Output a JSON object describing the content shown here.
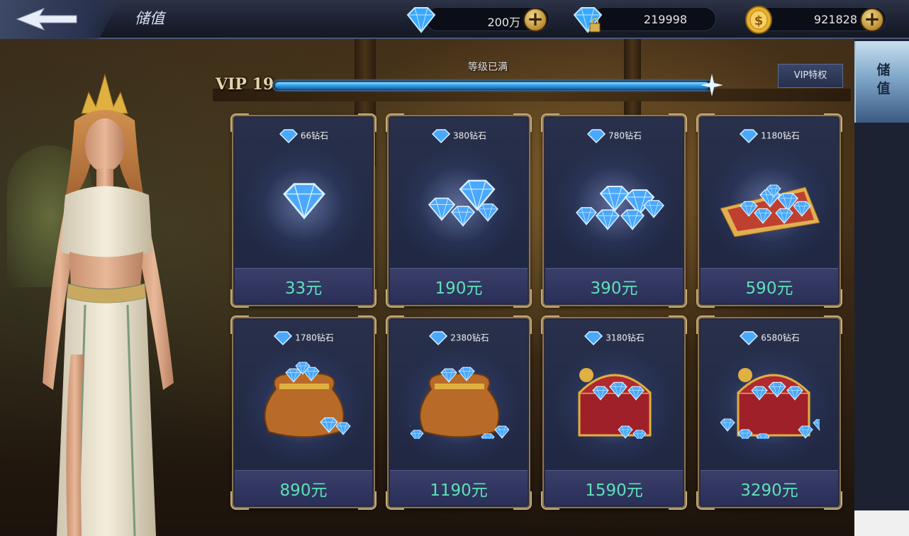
{
  "header": {
    "title": "储值",
    "currencies": [
      {
        "icon": "diamond-icon",
        "amount": "200万"
      },
      {
        "icon": "locked-diamond-icon",
        "amount": "219998"
      },
      {
        "icon": "gold-coin-icon",
        "amount": "921828"
      }
    ]
  },
  "vip": {
    "label": "VIP 19",
    "status": "等级已满",
    "progress": 1.0,
    "privilege_button": "VIP特权"
  },
  "side_tab": {
    "label": "储值"
  },
  "products": [
    {
      "gems": "66钻石",
      "price": "33元",
      "art": "single-diamond"
    },
    {
      "gems": "380钻石",
      "price": "190元",
      "art": "diamond-pile-small"
    },
    {
      "gems": "780钻石",
      "price": "390元",
      "art": "diamond-pile-medium"
    },
    {
      "gems": "1180钻石",
      "price": "590元",
      "art": "diamond-carpet"
    },
    {
      "gems": "1780钻石",
      "price": "890元",
      "art": "diamond-sack"
    },
    {
      "gems": "2380钻石",
      "price": "1190元",
      "art": "diamond-sack-spill"
    },
    {
      "gems": "3180钻石",
      "price": "1590元",
      "art": "treasure-chest"
    },
    {
      "gems": "6580钻石",
      "price": "3290元",
      "art": "treasure-chest-large"
    }
  ],
  "colors": {
    "price_text": "#5fe0b8",
    "vip_bar": "#2fa0ea",
    "card_border": "#8a7452"
  }
}
